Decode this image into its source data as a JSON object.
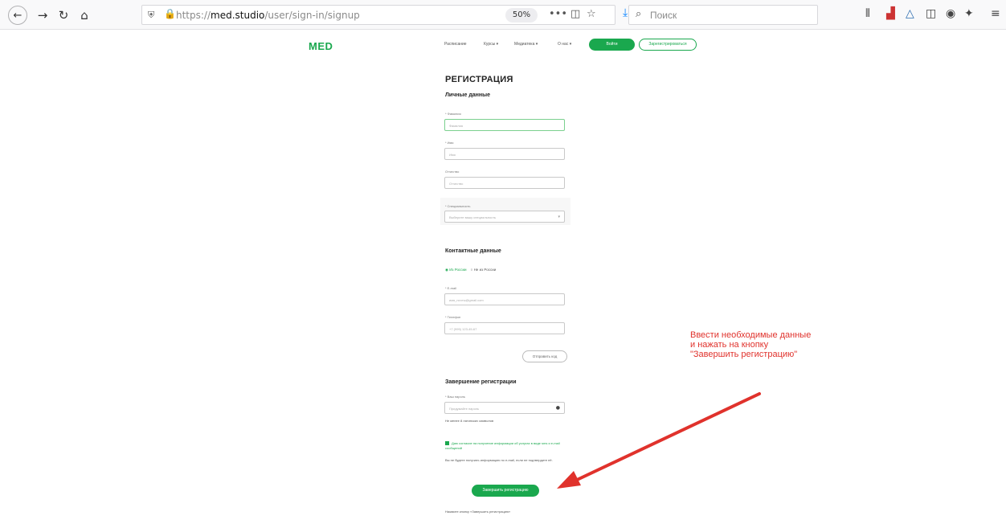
{
  "browser": {
    "url_prefix": "https://",
    "url_domain": "med.studio",
    "url_path": "/user/sign-in/signup",
    "zoom": "50%",
    "more_label": "•••",
    "search_placeholder": "Поиск"
  },
  "site": {
    "logo": "MED",
    "nav": [
      "Расписание",
      "Курсы ▾",
      "Медиатека ▾",
      "О нас ▾"
    ],
    "login_label": "Войти",
    "register_label": "Зарегистрироваться"
  },
  "form": {
    "title": "РЕГИСТРАЦИЯ",
    "personal_section": "Личные данные",
    "surname_label": "* Фамилия",
    "surname_placeholder": "Фамилия",
    "name_label": "* Имя",
    "name_placeholder": "Имя",
    "patronymic_label": "Отчество",
    "patronymic_placeholder": "Отчество",
    "specialty_label": "* Специальность",
    "specialty_placeholder": "Выберите вашу специальность",
    "contacts_section": "Контактные данные",
    "radio_russia": "Из России",
    "radio_abroad": "Не из России",
    "email_label": "* E-mail",
    "email_placeholder": "имя_почты@gmail.com",
    "phone_label": "* Телефон",
    "phone_placeholder": "+7 (999) 123-45-67",
    "send_code_label": "Отправить код",
    "finish_section": "Завершение регистрации",
    "password_label": "* Ваш пароль",
    "password_placeholder": "Придумайте пароль",
    "password_hint": "Не менее 8 латинских символов",
    "consent_text": "Даю согласие на получение информации об услугах в виде sms и e-mail сообщений",
    "consent_note": "Вы не будете получать информацию по e-mail, если не подтвердите её.",
    "finish_button": "Завершить регистрацию",
    "bottom_note": "Нажмите кнопку «Завершить регистрацию»"
  },
  "annotation": {
    "line1": "Ввести необходимые данные",
    "line2": "и нажать на кнопку",
    "line3": "\"Завершить регистрацию\"",
    "color": "#e0322c"
  },
  "colors": {
    "brand_green": "#1aa84e"
  }
}
